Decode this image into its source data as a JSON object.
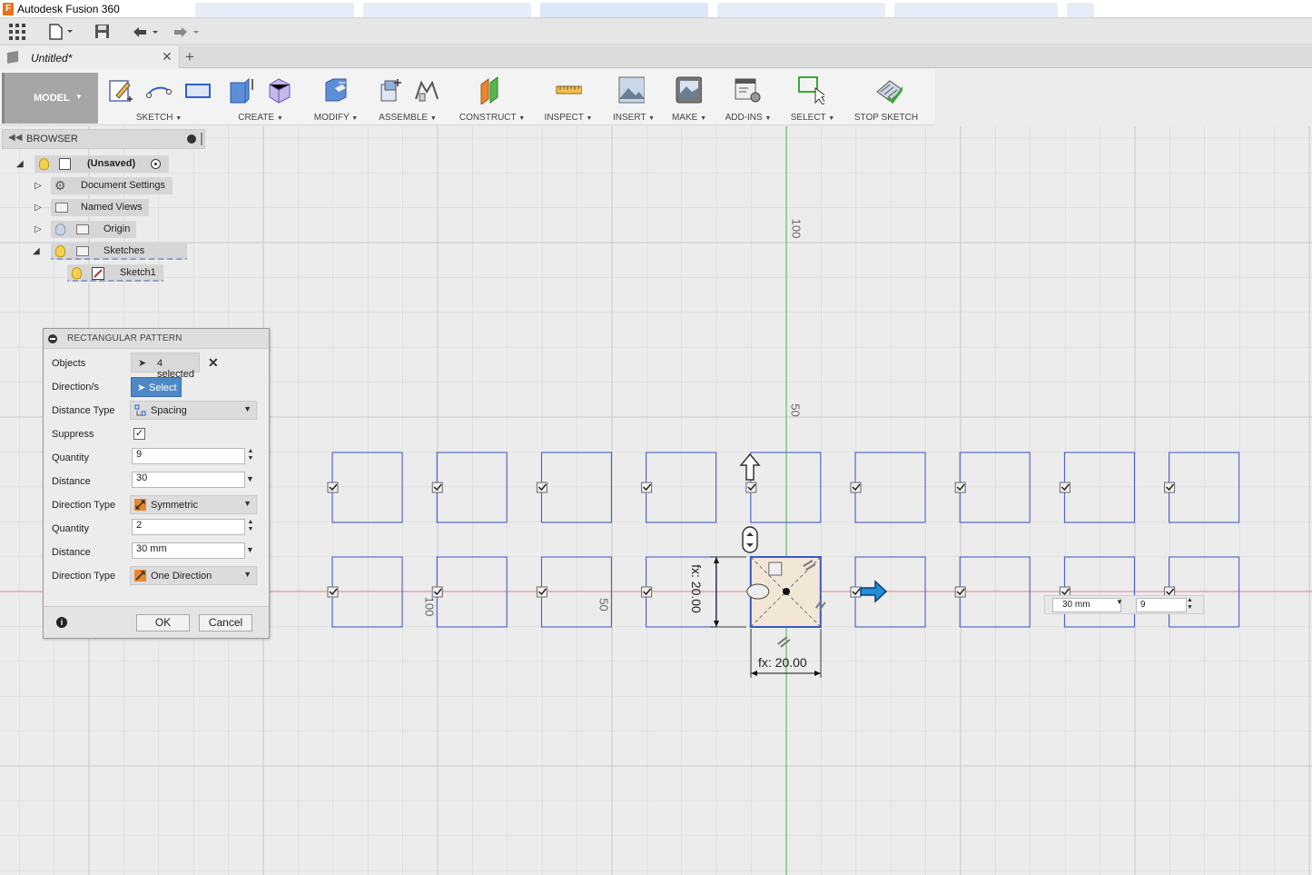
{
  "app": {
    "title": "Autodesk Fusion 360"
  },
  "document": {
    "tab_name": "Untitled*"
  },
  "ribbon": {
    "workspace": "MODEL",
    "groups": [
      {
        "label": "SKETCH"
      },
      {
        "label": "CREATE"
      },
      {
        "label": "MODIFY"
      },
      {
        "label": "ASSEMBLE"
      },
      {
        "label": "CONSTRUCT"
      },
      {
        "label": "INSPECT"
      },
      {
        "label": "INSERT"
      },
      {
        "label": "MAKE"
      },
      {
        "label": "ADD-INS"
      },
      {
        "label": "SELECT"
      },
      {
        "label": "STOP SKETCH"
      }
    ]
  },
  "browser": {
    "title": "BROWSER",
    "items": [
      {
        "label": "(Unsaved)"
      },
      {
        "label": "Document Settings"
      },
      {
        "label": "Named Views"
      },
      {
        "label": "Origin"
      },
      {
        "label": "Sketches"
      },
      {
        "label": "Sketch1"
      }
    ]
  },
  "dialog": {
    "title": "RECTANGULAR PATTERN",
    "objects_label": "Objects",
    "objects_value": "4 selected",
    "directions_label": "Direction/s",
    "directions_button": "Select",
    "distance_type_label": "Distance Type",
    "distance_type_value": "Spacing",
    "suppress_label": "Suppress",
    "suppress_checked": true,
    "quantity1_label": "Quantity",
    "quantity1_value": "9",
    "distance1_label": "Distance",
    "distance1_value": "30",
    "direction_type1_label": "Direction Type",
    "direction_type1_value": "Symmetric",
    "quantity2_label": "Quantity",
    "quantity2_value": "2",
    "distance2_label": "Distance",
    "distance2_value": "30 mm",
    "direction_type2_label": "Direction Type",
    "direction_type2_value": "One Direction",
    "ok_label": "OK",
    "cancel_label": "Cancel"
  },
  "canvas": {
    "ruler_100": "100",
    "ruler_50": "50",
    "vert_dimension": "fx: 20.00",
    "horiz_dimension": "fx: 20.00",
    "inline_distance": "30 mm",
    "inline_quantity": "9",
    "label_100_rot": "100",
    "label_50_rot": "50"
  },
  "colors": {
    "grid": "#d8d8d8",
    "sketch_blue": "#3d57c7",
    "selected_fill": "#f2e6d6",
    "axis_red": "#e08080",
    "axis_green": "#45b545",
    "arrow_blue": "#1f8fd8"
  }
}
